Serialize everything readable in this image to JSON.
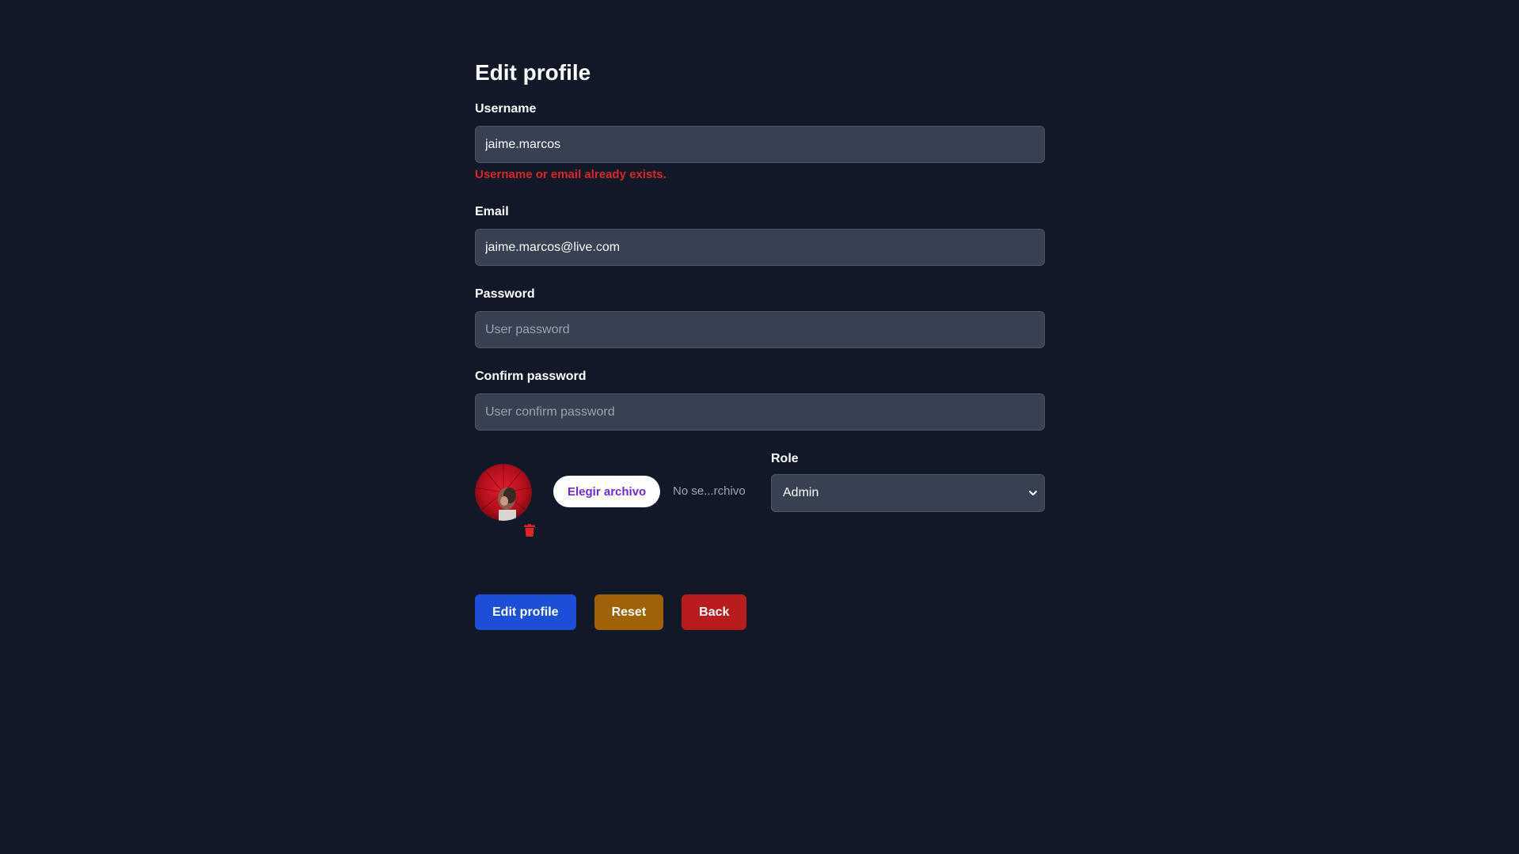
{
  "form": {
    "title": "Edit profile",
    "username": {
      "label": "Username",
      "value": "jaime.marcos",
      "error": "Username or email already exists."
    },
    "email": {
      "label": "Email",
      "value": "jaime.marcos@live.com"
    },
    "password": {
      "label": "Password",
      "placeholder": "User password"
    },
    "confirm_password": {
      "label": "Confirm password",
      "placeholder": "User confirm password"
    },
    "avatar": {
      "file_button_label": "Elegir archivo",
      "file_status": "No se...rchivo"
    },
    "role": {
      "label": "Role",
      "selected": "Admin"
    }
  },
  "actions": {
    "submit_label": "Edit profile",
    "reset_label": "Reset",
    "back_label": "Back"
  },
  "colors": {
    "background": "#111827",
    "input_background": "#374151",
    "error": "#dc2626",
    "primary": "#1d4ed8",
    "warning": "#a16207",
    "danger": "#b91c1c",
    "file_button_text": "#6d28d9"
  },
  "icons": {
    "delete_avatar": "trash-icon",
    "role_dropdown": "chevron-down-icon"
  }
}
